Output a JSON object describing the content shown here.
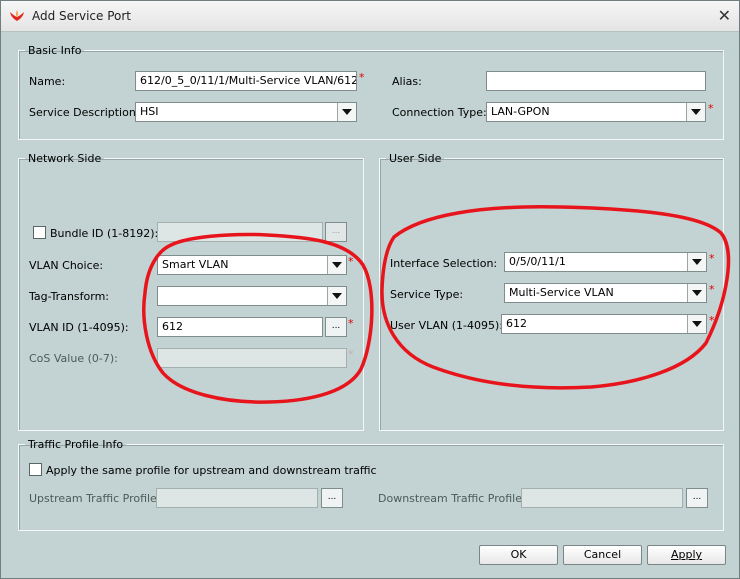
{
  "window": {
    "title": "Add Service Port",
    "close_glyph": "✕",
    "title_icon": "app-logo-icon"
  },
  "basic_info": {
    "legend": "Basic Info",
    "name_label": "Name:",
    "name_value": "612/0_5_0/11/1/Multi-Service VLAN/612",
    "alias_label": "Alias:",
    "alias_value": "",
    "service_desc_label": "Service Description:",
    "service_desc_value": "HSI",
    "connection_type_label": "Connection Type:",
    "connection_type_value": "LAN-GPON"
  },
  "network_side": {
    "legend": "Network Side",
    "bundle_label": "Bundle ID (1-8192):",
    "bundle_checked": false,
    "bundle_value": "",
    "vlan_choice_label": "VLAN Choice:",
    "vlan_choice_value": "Smart VLAN",
    "tag_transform_label": "Tag-Transform:",
    "tag_transform_value": "",
    "vlan_id_label": "VLAN ID (1-4095):",
    "vlan_id_value": "612",
    "cos_label": "CoS Value (0-7):",
    "cos_value": ""
  },
  "user_side": {
    "legend": "User Side",
    "interface_label": "Interface Selection:",
    "interface_value": "0/5/0/11/1",
    "service_type_label": "Service Type:",
    "service_type_value": "Multi-Service VLAN",
    "user_vlan_label": "User VLAN (1-4095):",
    "user_vlan_value": "612"
  },
  "traffic_profile": {
    "legend": "Traffic Profile Info",
    "same_profile_label": "Apply the same profile for upstream and downstream traffic",
    "same_profile_checked": false,
    "upstream_label": "Upstream Traffic Profile:",
    "upstream_value": "",
    "downstream_label": "Downstream Traffic Profile:",
    "downstream_value": ""
  },
  "common": {
    "required_mark": "*",
    "browse_label": "..."
  },
  "buttons": {
    "ok": "OK",
    "cancel": "Cancel",
    "apply": "Apply"
  },
  "colors": {
    "dialog_bg": "#c3d2d2",
    "required": "#e00000",
    "annotation": "#e8141c"
  }
}
